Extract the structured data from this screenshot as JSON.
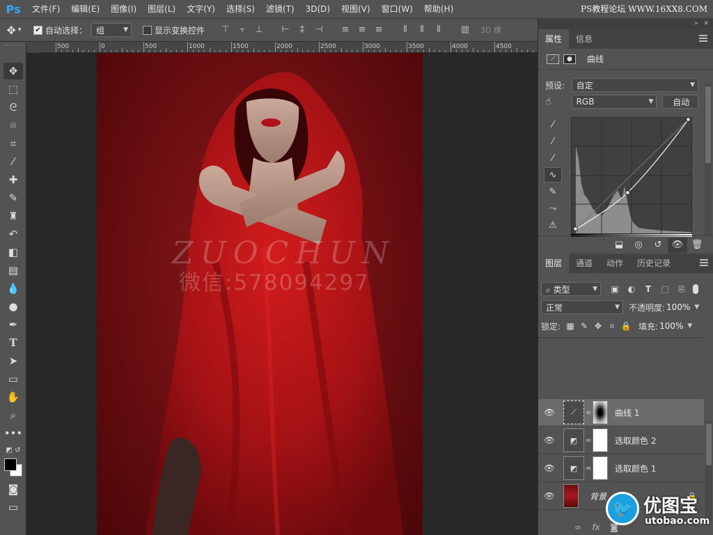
{
  "app": {
    "logo": "Ps"
  },
  "menu": [
    "文件(F)",
    "编辑(E)",
    "图像(I)",
    "图层(L)",
    "文字(Y)",
    "选择(S)",
    "滤镜(T)",
    "3D(D)",
    "视图(V)",
    "窗口(W)",
    "帮助(H)"
  ],
  "top_watermark": "PS教程论坛 WWW.16XX8.COM",
  "options": {
    "auto_select_label": "自动选择：",
    "auto_select_checked": true,
    "auto_select_value": "组",
    "transform_label": "显示变换控件",
    "mode_3d": "3D 模"
  },
  "ruler": {
    "labels": [
      "500",
      "0",
      "500",
      "1000",
      "1500",
      "2000",
      "2500",
      "3000",
      "3500",
      "4000",
      "4500"
    ]
  },
  "photo_watermark": {
    "line1": "ZUOCHUN",
    "line2": "微信:578094297"
  },
  "properties": {
    "tabs": [
      "属性",
      "信息"
    ],
    "active_tab": 0,
    "title": "曲线",
    "preset_label": "预设:",
    "preset_value": "自定",
    "channel_value": "RGB",
    "auto_button": "自动"
  },
  "layers": {
    "tabs": [
      "图层",
      "通道",
      "动作",
      "历史记录"
    ],
    "active_tab": 0,
    "filter_value": "类型",
    "blend_mode": "正常",
    "opacity_label": "不透明度:",
    "opacity_value": "100%",
    "lock_label": "锁定:",
    "fill_label": "填充:",
    "fill_value": "100%",
    "items": [
      {
        "name": "曲线 1",
        "selected": true
      },
      {
        "name": "选取颜色 2",
        "selected": false
      },
      {
        "name": "选取颜色 1",
        "selected": false
      },
      {
        "name": "背景",
        "selected": false
      }
    ]
  },
  "site_logo": {
    "name": "优图宝",
    "url": "utobao.com"
  }
}
